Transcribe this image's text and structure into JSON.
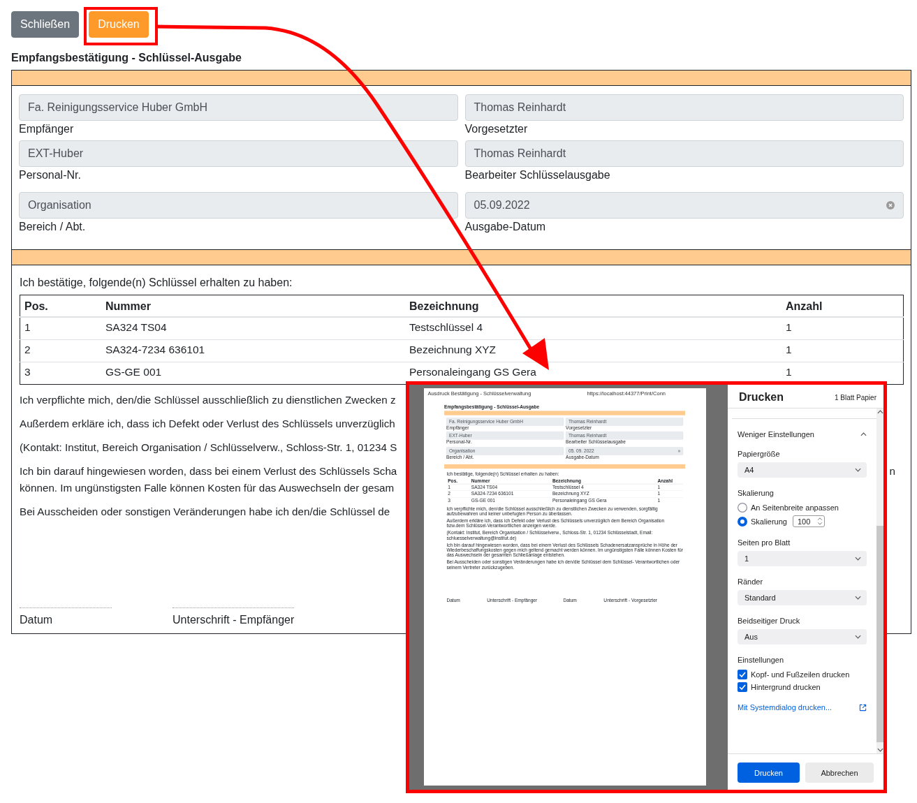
{
  "toolbar": {
    "buttons": [
      {
        "label": "Schließen",
        "kind": "secondary",
        "highlighted": false
      },
      {
        "label": "Drucken",
        "kind": "warning",
        "highlighted": true
      }
    ]
  },
  "form": {
    "title": "Empfangsbestätigung - Schlüssel-Ausgabe",
    "fields": [
      {
        "value": "Fa. Reinigungsservice Huber GmbH",
        "label": "Empfänger",
        "clearable": false
      },
      {
        "value": "Thomas Reinhardt",
        "label": "Vorgesetzter",
        "clearable": false
      },
      {
        "value": "EXT-Huber",
        "label": "Personal-Nr.",
        "clearable": false
      },
      {
        "value": "Thomas Reinhardt",
        "label": "Bearbeiter Schlüsselausgabe",
        "clearable": false
      },
      {
        "value": "Organisation",
        "label": "Bereich / Abt.",
        "clearable": false
      },
      {
        "value": "05.09.2022",
        "label": "Ausgabe-Datum",
        "clearable": true
      }
    ],
    "intro": "Ich bestätige, folgende(n) Schlüssel erhalten zu haben:",
    "table": {
      "columns": [
        "Pos.",
        "Nummer",
        "Bezeichnung",
        "Anzahl"
      ],
      "rows": [
        [
          "1",
          "SA324 TS04",
          "Testschlüssel 4",
          "1"
        ],
        [
          "2",
          "SA324-7234 636101",
          "Bezeichnung XYZ",
          "1"
        ],
        [
          "3",
          "GS-GE 001",
          "Personaleingang GS Gera",
          "1"
        ]
      ]
    },
    "paragraphs": [
      {
        "lines": [
          "Ich verpflichte mich, den/die Schlüssel ausschließlich zu dienstlichen Zwecken z"
        ]
      },
      {
        "lines": [
          "Außerdem erkläre ich, dass ich Defekt oder Verlust des Schlüssels unverzüglich"
        ]
      },
      {
        "lines": [
          "(Kontakt: Institut, Bereich Organisation / Schlüsselverw., Schloss-Str. 1, 01234 S"
        ]
      },
      {
        "lines": [
          "Ich bin darauf hingewiesen worden, dass bei einem Verlust des Schlüssels Scha",
          "können. Im ungünstigsten Falle können Kosten für das Auswechseln der gesam"
        ],
        "tail": "n"
      },
      {
        "lines": [
          "Bei Ausscheiden oder sonstigen Veränderungen habe ich den/die Schlüssel de"
        ]
      }
    ],
    "signatures": [
      "Datum",
      "Unterschrift - Empfänger"
    ]
  },
  "print_dialog": {
    "preview": {
      "header_title": "Ausdruck Bestätigung - Schlüsselverwaltung",
      "header_url": "https://localhost:44377/Print/Conn",
      "document": {
        "title": "Empfangsbestätigung - Schlüssel-Ausgabe",
        "fields": [
          {
            "value": "Fa. Reinigungsservice Huber GmbH",
            "label": "Empfänger",
            "clearable": false
          },
          {
            "value": "Thomas Reinhardt",
            "label": "Vorgesetzter",
            "clearable": false
          },
          {
            "value": "EXT-Huber",
            "label": "Personal-Nr.",
            "clearable": false
          },
          {
            "value": "Thomas Reinhardt",
            "label": "Bearbeiter Schlüsselausgabe",
            "clearable": false
          },
          {
            "value": "Organisation",
            "label": "Bereich / Abt.",
            "clearable": false
          },
          {
            "value": "05. 09. 2022",
            "label": "Ausgabe-Datum",
            "clearable": true
          }
        ],
        "intro": "Ich bestätige, folgende(n) Schlüssel erhalten zu haben:",
        "table": {
          "columns": [
            "Pos.",
            "Nummer",
            "Bezeichnung",
            "Anzahl"
          ],
          "rows": [
            [
              "1",
              "SA324 TS04",
              "Testschlüssel 4",
              "1"
            ],
            [
              "2",
              "SA324-7234 636101",
              "Bezeichnung XYZ",
              "1"
            ],
            [
              "3",
              "GS-GE 001",
              "Personaleingang GS Gera",
              "1"
            ]
          ]
        },
        "paragraphs": [
          {
            "text": "Ich verpflichte mich, den/die Schlüssel ausschließlich zu dienstlichen Zwecken zu verwenden, sorgfältig aufzubewahren und keiner unbefugten Person zu überlassen."
          },
          {
            "text": "Außerdem erkläre ich, dass ich Defekt oder Verlust des Schlüssels unverzüglich dem Bereich Organisation bzw.dem Schlüssel-Verantwortlichen anzeigen werde."
          },
          {
            "text": "(Kontakt: Institut, Bereich Organisation / Schlüsselverw., Schloss-Str. 1, 01234 Schlüsselstadt, Email: schluesselverwaltung@institut.de)"
          },
          {
            "text": "Ich bin darauf hingewiesen worden, dass bei einem Verlust des Schlüssels Schadenersatzansprüche in Höhe der Wiederbeschaffungskosten gegen mich geltend gemacht werden können. Im ungünstigsten Falle können Kosten für das Auswechseln der gesamten Schließanlage entstehen."
          },
          {
            "text": "Bei Ausscheiden oder sonstigen Veränderungen habe ich den/die Schlüssel dem Schlüssel- Verantwortlichen oder seinem Vertreter zurückzugeben."
          }
        ],
        "signatures": [
          "Datum",
          "Unterschrift - Empfänger",
          "Datum",
          "Unterschrift - Vorgesetzter"
        ]
      }
    },
    "title": "Drucken",
    "sheets": "1 Blatt Papier",
    "settings": [
      {
        "kind": "section",
        "label": "Weniger Einstellungen",
        "expanded": true
      },
      {
        "kind": "select",
        "label": "Papiergröße",
        "value": "A4"
      },
      {
        "kind": "radios",
        "label": "Skalierung",
        "options": [
          {
            "label": "An Seitenbreite anpassen",
            "selected": false
          },
          {
            "label": "Skalierung",
            "selected": true,
            "input": "100"
          }
        ]
      },
      {
        "kind": "select",
        "label": "Seiten pro Blatt",
        "value": "1"
      },
      {
        "kind": "select",
        "label": "Ränder",
        "value": "Standard"
      },
      {
        "kind": "select",
        "label": "Beidseitiger Druck",
        "value": "Aus"
      },
      {
        "kind": "checkboxes",
        "label": "Einstellungen",
        "options": [
          {
            "label": "Kopf- und Fußzeilen drucken",
            "checked": true
          },
          {
            "label": "Hintergrund drucken",
            "checked": true
          }
        ]
      },
      {
        "kind": "link",
        "label": "Mit Systemdialog drucken..."
      }
    ],
    "buttons": [
      {
        "label": "Drucken",
        "kind": "primary"
      },
      {
        "label": "Abbrechen",
        "kind": "secondary"
      }
    ]
  }
}
